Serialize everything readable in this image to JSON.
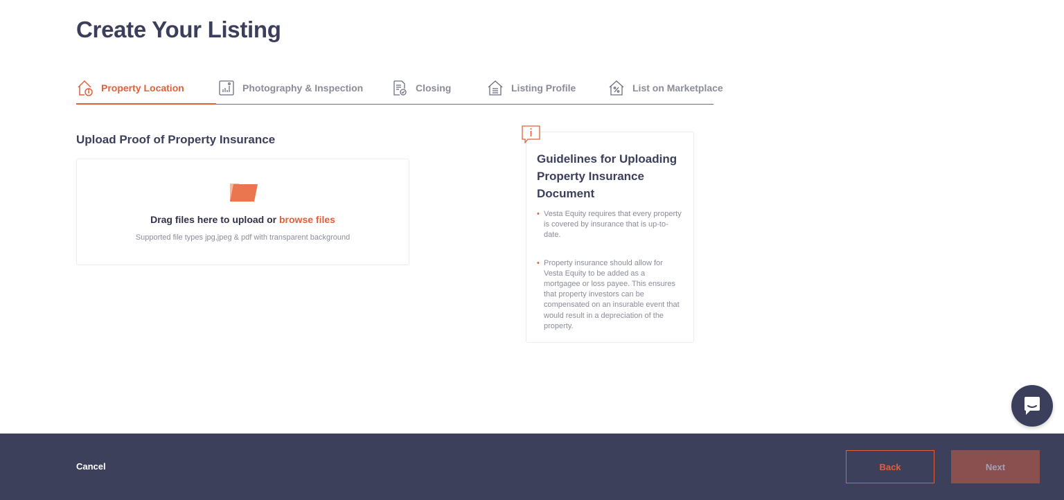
{
  "page": {
    "title": "Create Your Listing"
  },
  "stepper": {
    "steps": [
      {
        "label": "Property Location",
        "icon": "house-info-icon",
        "active": true
      },
      {
        "label": "Photography & Inspection",
        "icon": "chart-photo-icon",
        "active": false
      },
      {
        "label": "Closing",
        "icon": "document-check-icon",
        "active": false
      },
      {
        "label": "Listing Profile",
        "icon": "house-list-icon",
        "active": false
      },
      {
        "label": "List on Marketplace",
        "icon": "house-percent-icon",
        "active": false
      }
    ]
  },
  "upload": {
    "section_title": "Upload Proof of Property Insurance",
    "drag_text": "Drag files here to upload or ",
    "browse_text": "browse files",
    "hint": "Supported file types jpg,jpeg & pdf with transparent background",
    "icon": "folder-icon"
  },
  "guidelines": {
    "title": "Guidelines for Uploading Property Insurance Document",
    "items": [
      "Vesta Equity requires that every property is covered by insurance that is up-to-date.",
      "Property insurance should allow for Vesta Equity to be added as a mortgagee or loss payee. This ensures that property investors can be compensated on an insurable event that would result in a depreciation of the property."
    ],
    "badge_icon": "info-icon",
    "bullet": "•"
  },
  "footer": {
    "cancel_label": "Cancel",
    "back_label": "Back",
    "next_label": "Next"
  },
  "chat": {
    "icon": "chat-bubble-icon"
  },
  "colors": {
    "accent": "#e0603a",
    "primary": "#3b3f5c",
    "footer_bg": "#3d405b",
    "muted": "#8a8c99",
    "next_disabled": "#8a5050"
  }
}
